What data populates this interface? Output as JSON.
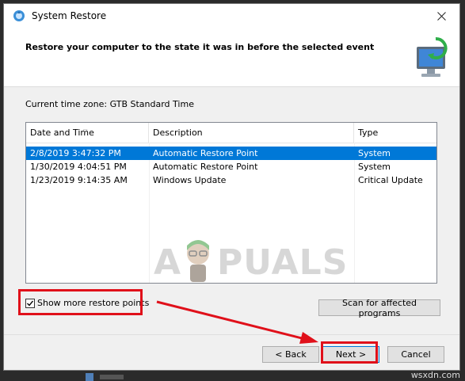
{
  "window": {
    "title": "System Restore",
    "header_title": "Restore your computer to the state it was in before the selected event"
  },
  "timezone_label": "Current time zone: GTB Standard Time",
  "table": {
    "columns": [
      "Date and Time",
      "Description",
      "Type"
    ],
    "rows": [
      {
        "date": "2/8/2019 3:47:32 PM",
        "description": "Automatic Restore Point",
        "type": "System",
        "selected": true
      },
      {
        "date": "1/30/2019 4:04:51 PM",
        "description": "Automatic Restore Point",
        "type": "System",
        "selected": false
      },
      {
        "date": "1/23/2019 9:14:35 AM",
        "description": "Windows Update",
        "type": "Critical Update",
        "selected": false
      }
    ]
  },
  "show_more": {
    "label": "Show more restore points",
    "checked": true
  },
  "buttons": {
    "scan": "Scan for affected programs",
    "back": "< Back",
    "next": "Next >",
    "cancel": "Cancel"
  },
  "watermark": {
    "left": "A",
    "right": "PUALS"
  },
  "credit": "wsxdn.com",
  "colors": {
    "selection": "#0078d7",
    "highlight": "#e0101a"
  },
  "icons": [
    "system-restore-icon",
    "close-icon",
    "monitor-restore-icon",
    "sort-arrow-icon",
    "check-icon"
  ]
}
